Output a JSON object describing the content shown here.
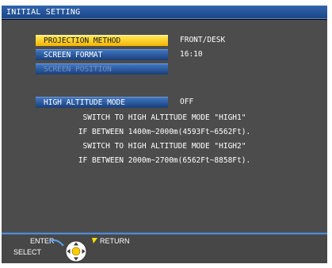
{
  "title": "INITIAL SETTING",
  "menu": {
    "items": [
      {
        "label": "PROJECTION METHOD",
        "value": "FRONT/DESK",
        "state": "selected"
      },
      {
        "label": "SCREEN FORMAT",
        "value": "16:10",
        "state": "normal"
      },
      {
        "label": "SCREEN POSITION",
        "value": "",
        "state": "disabled"
      },
      {
        "label": "HIGH ALTITUDE MODE",
        "value": "OFF",
        "state": "normal"
      }
    ]
  },
  "message": {
    "lines": [
      "SWITCH TO HIGH ALTITUDE MODE \"HIGH1\"",
      "IF BETWEEN 1400m~2000m(4593Ft~6562Ft).",
      "SWITCH TO HIGH ALTITUDE MODE \"HIGH2\"",
      "IF BETWEEN 2000m~2700m(6562Ft~8858Ft)."
    ]
  },
  "footer": {
    "enter_label": "ENTER",
    "select_label": "SELECT",
    "return_label": "RETURN"
  },
  "colors": {
    "selected_bg": "#f7c800",
    "item_bg": "#2d5da3",
    "panel_bg": "#4c4c4c",
    "return_arrow": "#ffdd00"
  }
}
